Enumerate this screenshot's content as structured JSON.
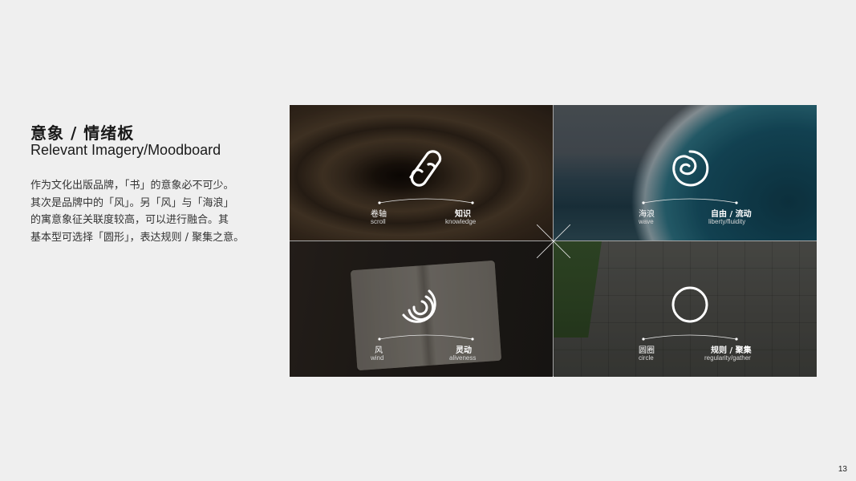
{
  "header": {
    "title_cn": "意象 / 情绪板",
    "title_en": "Relevant Imagery/Moodboard"
  },
  "body": {
    "lines": [
      "作为文化出版品牌，「书」的意象必不可少。",
      "其次是品牌中的「风」。另「风」与「海浪」",
      "的寓意象征关联度较高，可以进行融合。其",
      "基本型可选择「圆形」，表达规则 / 聚集之意。"
    ]
  },
  "moodboard": {
    "tiles": [
      {
        "icon": "scroll-icon",
        "left_cn": "卷轴",
        "left_en": "scroll",
        "right_cn": "知识",
        "right_en": "knowledge"
      },
      {
        "icon": "wave-spiral-icon",
        "left_cn": "海浪",
        "left_en": "wave",
        "right_cn": "自由 / 流动",
        "right_en": "liberty/fluidity"
      },
      {
        "icon": "wind-swirl-icon",
        "left_cn": "风",
        "left_en": "wind",
        "right_cn": "灵动",
        "right_en": "aliveness"
      },
      {
        "icon": "circle-icon",
        "left_cn": "圆圈",
        "left_en": "circle",
        "right_cn": "规则 / 聚集",
        "right_en": "regularity/gather"
      }
    ]
  },
  "page_number": "13"
}
